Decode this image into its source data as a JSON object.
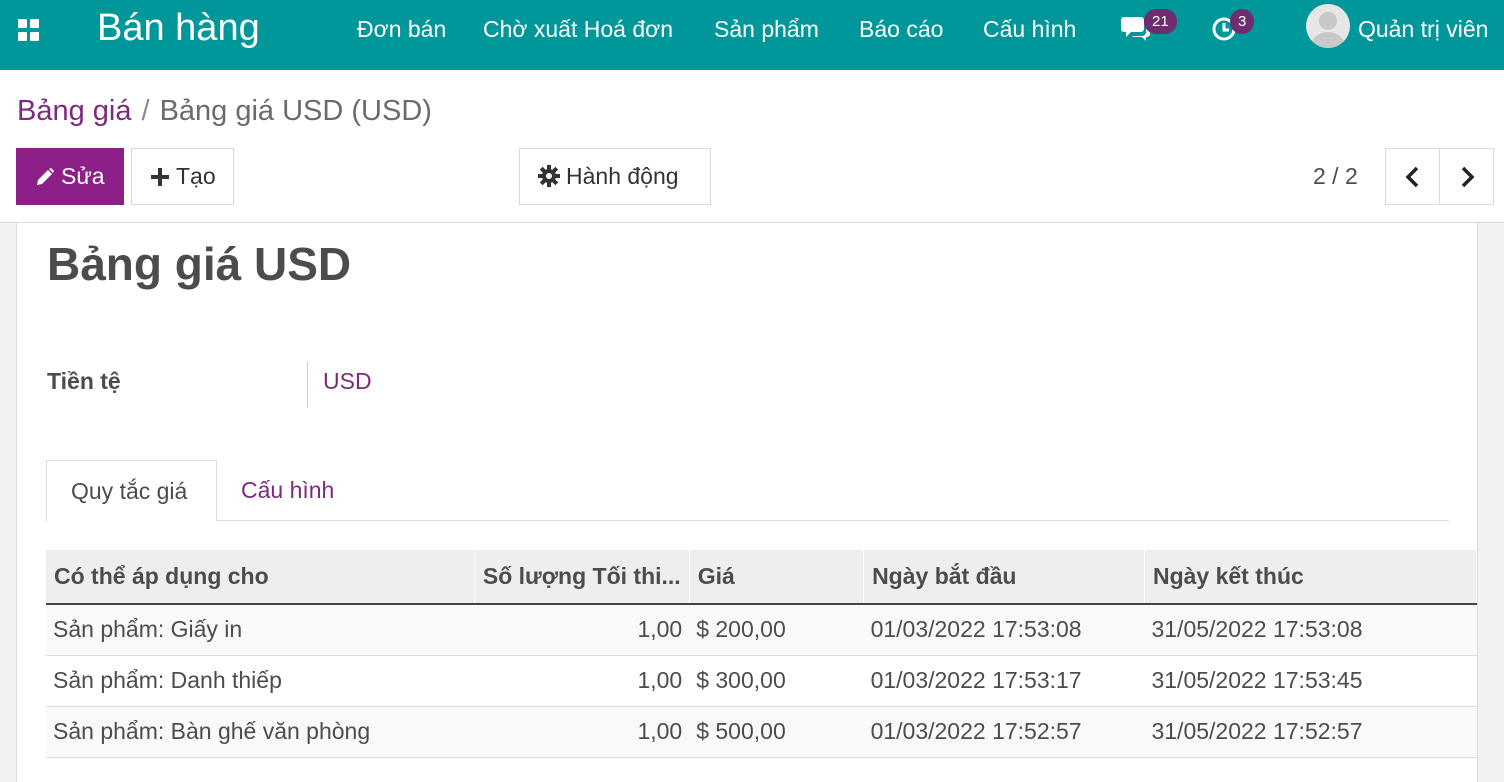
{
  "navbar": {
    "app_title": "Bán hàng",
    "menu": [
      "Đơn bán",
      "Chờ xuất Hoá đơn",
      "Sản phẩm",
      "Báo cáo",
      "Cấu hình"
    ],
    "messages_badge": "21",
    "activities_badge": "3",
    "user_name": "Quản trị viên",
    "colors": {
      "bar": "#00979b",
      "badge": "#6e2d6f"
    }
  },
  "breadcrumb": {
    "parent": "Bảng giá",
    "separator": "/",
    "current": "Bảng giá USD (USD)"
  },
  "toolbar": {
    "edit_label": "Sửa",
    "create_label": "Tạo",
    "action_label": "Hành động",
    "pager_value": "2 / 2"
  },
  "record": {
    "title": "Bảng giá USD",
    "currency_label": "Tiền tệ",
    "currency_value": "USD"
  },
  "tabs": [
    {
      "label": "Quy tắc giá",
      "active": true
    },
    {
      "label": "Cấu hình",
      "active": false
    }
  ],
  "table": {
    "columns": [
      "Có thể áp dụng cho",
      "Số lượng Tối thi...",
      "Giá",
      "Ngày bắt đầu",
      "Ngày kết thúc"
    ],
    "rows": [
      [
        "Sản phẩm: Giấy in",
        "1,00",
        "$ 200,00",
        "01/03/2022 17:53:08",
        "31/05/2022 17:53:08"
      ],
      [
        "Sản phẩm: Danh thiếp",
        "1,00",
        "$ 300,00",
        "01/03/2022 17:53:17",
        "31/05/2022 17:53:45"
      ],
      [
        "Sản phẩm: Bàn ghế văn phòng",
        "1,00",
        "$ 500,00",
        "01/03/2022 17:52:57",
        "31/05/2022 17:52:57"
      ]
    ]
  },
  "colors": {
    "primary": "#8c1f88",
    "link": "#7c2a7c"
  }
}
